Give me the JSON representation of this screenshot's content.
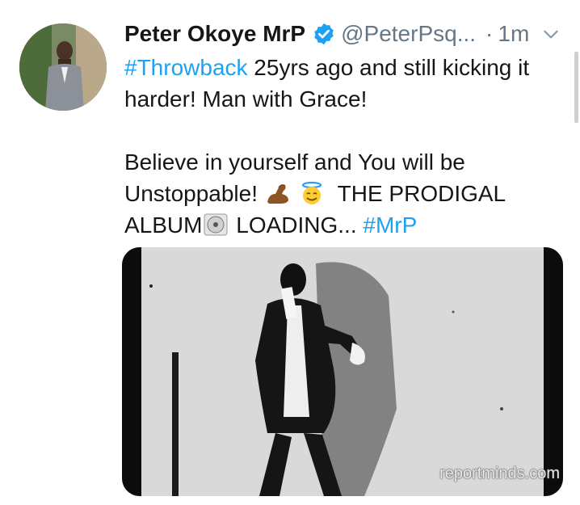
{
  "tweet": {
    "display_name": "Peter Okoye MrP",
    "handle": "@PeterPsq...",
    "separator": "·",
    "timestamp": "1m",
    "hashtag_1": "#Throwback",
    "line_1_rest": " 25yrs ago and still kicking it harder! Man with Grace!",
    "line_2_a": "Believe in yourself and You will be Unstoppable! ",
    "line_2_b": "THE PRODIGAL ALBUM",
    "line_2_c": " LOADING... ",
    "hashtag_2": "#MrP",
    "watermark": "reportminds.com"
  },
  "icons": {
    "verified": "verified-badge-icon",
    "more": "chevron-down-icon",
    "emoji_1": "flexed-biceps-emoji",
    "emoji_2": "halo-smile-emoji",
    "emoji_3": "disc-emoji"
  },
  "colors": {
    "link": "#1da1f2",
    "muted": "#657786",
    "text": "#14171a"
  }
}
